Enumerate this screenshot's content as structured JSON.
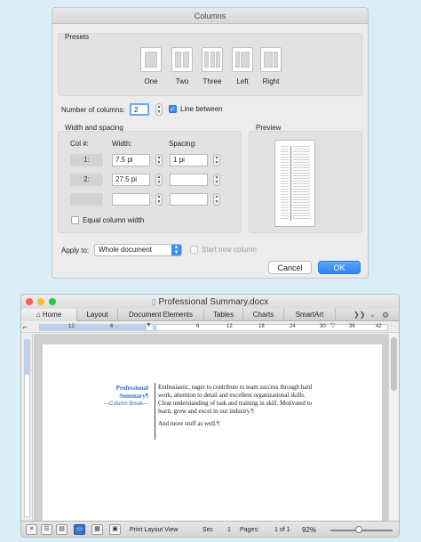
{
  "dialog": {
    "title": "Columns",
    "presets_label": "Presets",
    "presets": [
      "One",
      "Two",
      "Three",
      "Left",
      "Right"
    ],
    "number_of_columns_label": "Number of columns:",
    "number_of_columns_value": "2",
    "line_between_label": "Line between",
    "line_between_checked": true,
    "width_spacing_label": "Width and spacing",
    "col_header": "Col #:",
    "width_header": "Width:",
    "spacing_header": "Spacing:",
    "rows": [
      {
        "col": "1:",
        "width": "7.5 pi",
        "spacing": "1 pi"
      },
      {
        "col": "2:",
        "width": "27.5 pi",
        "spacing": ""
      },
      {
        "col": "",
        "width": "",
        "spacing": ""
      }
    ],
    "equal_width_label": "Equal column width",
    "preview_label": "Preview",
    "apply_to_label": "Apply to:",
    "apply_to_value": "Whole document",
    "start_new_column_label": "Start new column",
    "cancel_label": "Cancel",
    "ok_label": "OK"
  },
  "word": {
    "title": "Professional Summary.docx",
    "tabs": [
      "Home",
      "Layout",
      "Document Elements",
      "Tables",
      "Charts",
      "SmartArt"
    ],
    "ruler_numbers": [
      "12",
      "6",
      "6",
      "12",
      "18",
      "24",
      "30",
      "36",
      "42"
    ],
    "doc": {
      "heading_line1": "Professional",
      "heading_line2": "Summary",
      "column_break": "Column Break",
      "pilcrow": "¶",
      "body_lines": [
        "Enthusiastic, eager to contribute to team success through hard",
        "work, attention to detail and excellent organizational skills.",
        "Clear understanding of task and training in skill. Motivated to",
        "learn, grow and excel in our industry."
      ],
      "more_text": "And more stuff as well."
    },
    "status": {
      "view_label": "Print Layout View",
      "sec_label": "Sec",
      "sec_value": "1",
      "pages_label": "Pages:",
      "pages_value": "1 of 1",
      "zoom": "92%"
    }
  },
  "colors": {
    "accent": "#3b8ef0",
    "page_background": "#dbeef8",
    "heading_blue": "#2f6fbf"
  }
}
